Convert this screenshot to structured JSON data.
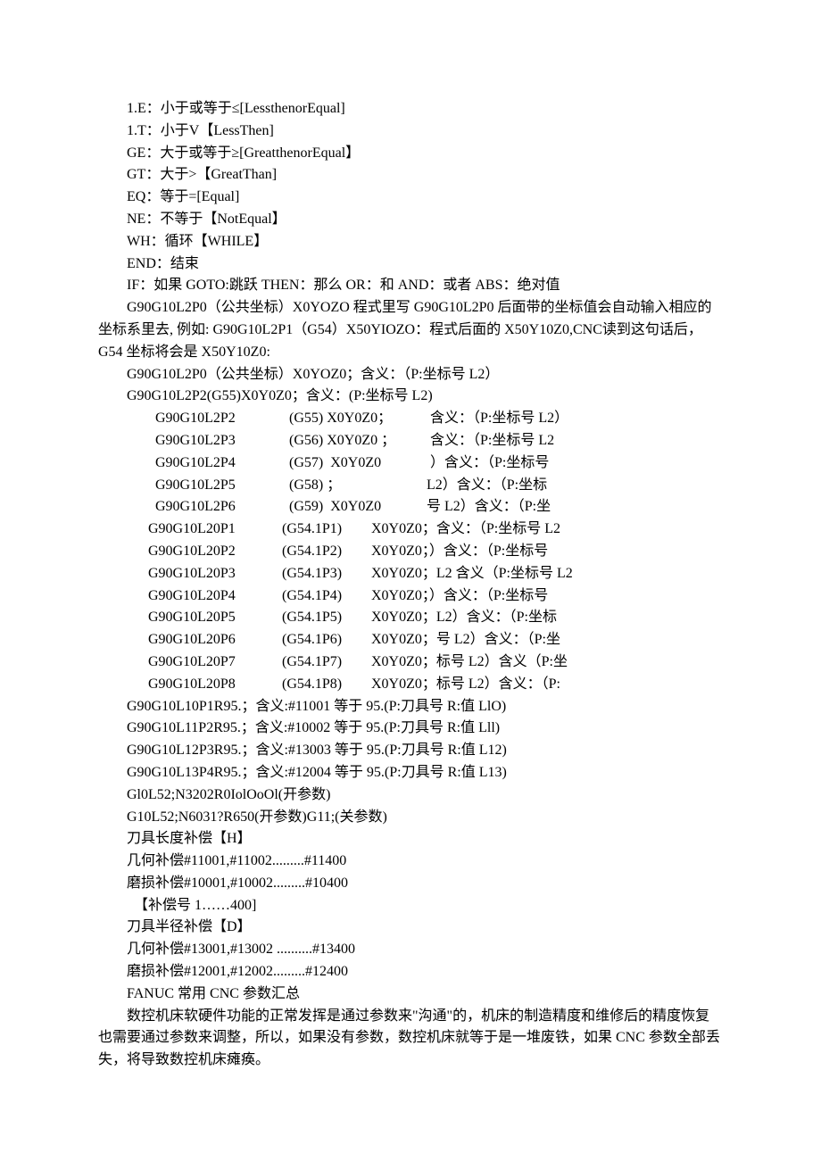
{
  "lines": [
    "1.E：小于或等于≤[LessthenorEqual]",
    "1.T：小于V【LessThen]",
    "GE：大于或等于≥[GreatthenorEqual】",
    "GT：大于>【GreatThan]",
    "EQ：等于=[Equal]",
    "NE：不等于【NotEqual】",
    "WH：循环【WHILE】",
    "END：结束",
    "IF：如果 GOTO:跳跃 THEN：那么 OR：和 AND：或者 ABS：绝对值"
  ],
  "para1": "G90G10L2P0（公共坐标）X0YOZO 程式里写 G90G10L2P0 后面带的坐标值会自动输入相应的坐标系里去, 例如: G90G10L2P1（G54）X50YIOZO：程式后面的 X50Y10Z0,CNC读到这句话后，G54 坐标将会是 X50Y10Z0:",
  "g1": "G90G10L2P0（公共坐标）X0YOZ0；含义：（P:坐标号 L2）",
  "g2": "G90G10L2P2(G55)X0Y0Z0；含义：(P:坐标号 L2)",
  "t1": {
    "col1": [
      "G90G10L2P2",
      "G90G10L2P3",
      "G90G10L2P4",
      "G90G10L2P5",
      "G90G10L2P6"
    ],
    "col2": [
      "(G55) X0Y0Z0；",
      "(G56) X0Y0Z0 ；",
      "(G57)  X0Y0Z0",
      "(G58) ；",
      "(G59)  X0Y0Z0"
    ],
    "col3": [
      "  含义：（P:坐标号 L2）",
      "  含义：（P:坐标号 L2",
      "  ）含义：（P:坐标号",
      " L2）含义：（P:坐标",
      " 号 L2）含义：（P:坐"
    ]
  },
  "t2": {
    "col1": [
      "G90G10L20P1",
      "G90G10L20P2",
      "G90G10L20P3",
      "G90G10L20P4",
      "G90G10L20P5",
      "G90G10L20P6",
      "G90G10L20P7",
      "G90G10L20P8"
    ],
    "col2": [
      "(G54.1P1)",
      "(G54.1P2)",
      "(G54.1P3)",
      "(G54.1P4)",
      "(G54.1P5)",
      "(G54.1P6)",
      "(G54.1P7)",
      "(G54.1P8)"
    ],
    "col3": [
      "X0Y0Z0；含义：（P:坐标号 L2",
      "X0Y0Z0；）含义：（P:坐标号",
      "X0Y0Z0；L2 含义（P:坐标号 L2",
      "X0Y0Z0；）含义：（P:坐标号",
      "X0Y0Z0；L2）含义：（P:坐标",
      "X0Y0Z0；号 L2）含义：（P:坐",
      "X0Y0Z0；标号 L2）含义（P:坐",
      "X0Y0Z0；标号 L2）含义：（P:"
    ]
  },
  "lines2": [
    "G90G10L10P1R95.；含义:#11001 等于 95.(P:刀具号 R:值 LlO)",
    "G90G10L11P2R95.；含义:#10002 等于 95.(P:刀具号 R:值 Lll)",
    "G90G10L12P3R95.；含义:#13003 等于 95.(P:刀具号 R:值 L12)",
    "G90G10L13P4R95.；含义:#12004 等于 95.(P:刀具号 R:值 L13)",
    "Gl0L52;N3202R0IolOoOl(开参数)",
    "G10L52;N6031?R650(开参数)G11;(关参数)",
    "刀具长度补偿【H】",
    "几何补偿#11001,#11002.........#11400",
    "磨损补偿#10001,#10002.........#10400",
    "【补偿号 1……400]",
    "刀具半径补偿【D】",
    "几何补偿#13001,#13002 ..........#13400",
    "磨损补偿#12001,#12002.........#12400",
    "FANUC 常用 CNC 参数汇总"
  ],
  "para2": "数控机床软硬件功能的正常发挥是通过参数来\"沟通\"的，机床的制造精度和维修后的精度恢复也需要通过参数来调整，所以，如果没有参数，数控机床就等于是一堆废铁，如果 CNC 参数全部丢失，将导致数控机床瘫痪。"
}
